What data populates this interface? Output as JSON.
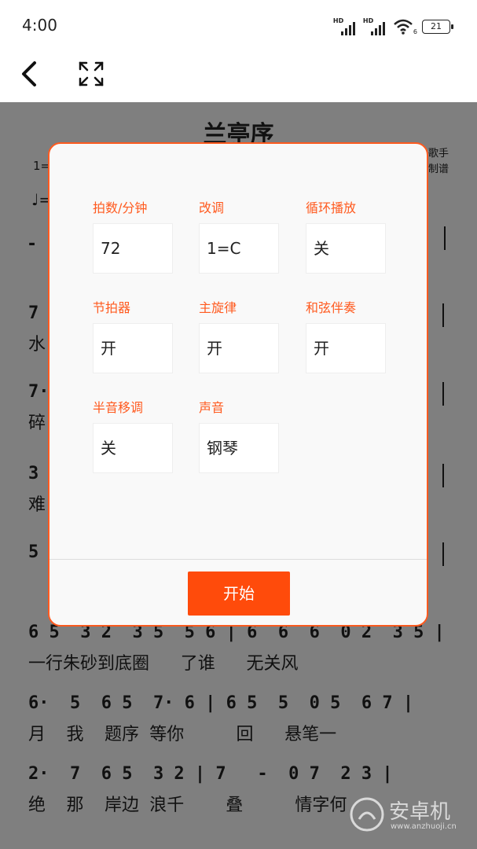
{
  "status": {
    "time": "4:00",
    "battery": "21",
    "signal_label": "HD",
    "wifi_sub": "6"
  },
  "toolbar": {
    "back": "back-arrow",
    "fullscreen": "fullscreen-icon"
  },
  "sheet": {
    "title": "兰亭序",
    "credit1": "歌手",
    "credit2": "制谱",
    "key_prefix": "1=",
    "tempo_prefix": "♩=",
    "rows": [
      {
        "notes": "7",
        "lyrics": "水"
      },
      {
        "notes": "7·",
        "lyrics": "碎"
      },
      {
        "notes": "3",
        "lyrics": "难"
      },
      {
        "notes": "5",
        "lyrics": ""
      },
      {
        "notes": "6 5  3 2  3 5  5 6 | 6  6  6  0 2  3 5 |",
        "lyrics": "一行朱砂到底圈   了谁   无关风"
      },
      {
        "notes": "6·  5  6 5  7· 6 | 6 5  5  0 5  6 7 |",
        "lyrics": "月  我  题序 等你     回   悬笔一"
      },
      {
        "notes": "2·  7  6 5  3 2 | 7   -  0 7  2 3 |",
        "lyrics": "绝  那  岸边 浪千    叠     情字何"
      }
    ]
  },
  "dialog": {
    "fields": [
      {
        "label": "拍数/分钟",
        "value": "72"
      },
      {
        "label": "改调",
        "value": "1=C"
      },
      {
        "label": "循环播放",
        "value": "关"
      },
      {
        "label": "节拍器",
        "value": "开"
      },
      {
        "label": "主旋律",
        "value": "开"
      },
      {
        "label": "和弦伴奏",
        "value": "开"
      },
      {
        "label": "半音移调",
        "value": "关"
      },
      {
        "label": "声音",
        "value": "钢琴"
      }
    ],
    "start_label": "开始"
  },
  "watermark": {
    "text": "安卓机",
    "url": "www.anzhuoji.cn"
  }
}
